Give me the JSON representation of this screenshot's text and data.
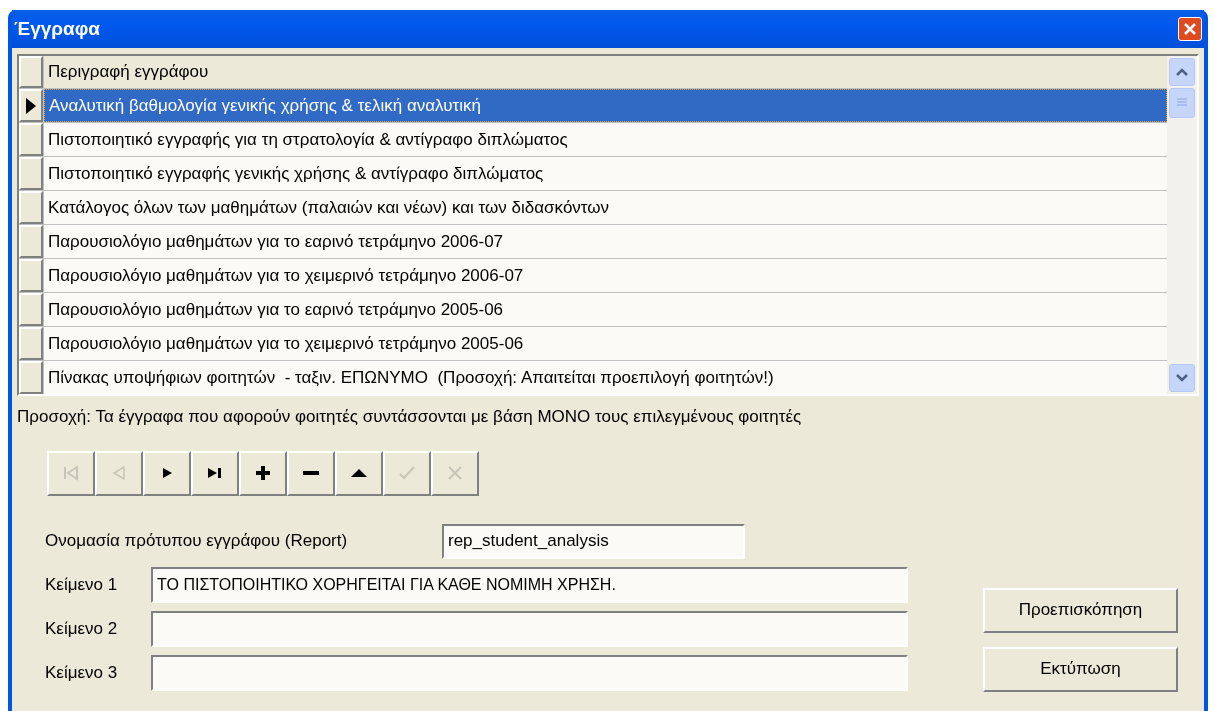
{
  "window": {
    "title": "Έγγραφα"
  },
  "table": {
    "columns": [
      "Περιγραφή εγγράφου"
    ],
    "rows": [
      {
        "text": "Αναλυτική βαθμολογία γενικής χρήσης & τελική αναλυτική",
        "selected": true
      },
      {
        "text": "Πιστοποιητικό εγγραφής για τη στρατολογία & αντίγραφο διπλώματος",
        "selected": false
      },
      {
        "text": "Πιστοποιητικό εγγραφής γενικής χρήσης & αντίγραφο διπλώματος",
        "selected": false
      },
      {
        "text": "Κατάλογος όλων των μαθημάτων (παλαιών και νέων) και των διδασκόντων",
        "selected": false
      },
      {
        "text": "Παρουσιολόγιο μαθημάτων για το εαρινό τετράμηνο 2006-07",
        "selected": false
      },
      {
        "text": "Παρουσιολόγιο μαθημάτων για το χειμερινό τετράμηνο 2006-07",
        "selected": false
      },
      {
        "text": "Παρουσιολόγιο μαθημάτων για το εαρινό τετράμηνο 2005-06",
        "selected": false
      },
      {
        "text": "Παρουσιολόγιο μαθημάτων για το χειμερινό τετράμηνο 2005-06",
        "selected": false
      },
      {
        "text": "Πίνακας υποψήφιων φοιτητών  - ταξιν. ΕΠΩΝΥΜΟ  (Προσοχή: Απαιτείται προεπιλογή φοιτητών!)",
        "selected": false
      }
    ]
  },
  "notice": "Προσοχή: Τα έγγραφα που αφορούν φοιτητές συντάσσονται με βάση ΜΟΝΟ τους επιλεγμένους φοιτητές",
  "navigator": [
    {
      "kind": "first",
      "disabled": true
    },
    {
      "kind": "previous",
      "disabled": true
    },
    {
      "kind": "next",
      "disabled": false
    },
    {
      "kind": "last",
      "disabled": false
    },
    {
      "kind": "add",
      "disabled": false
    },
    {
      "kind": "delete",
      "disabled": false
    },
    {
      "kind": "up",
      "disabled": false
    },
    {
      "kind": "save",
      "disabled": true
    },
    {
      "kind": "cancel",
      "disabled": true
    }
  ],
  "report_field": {
    "label": "Ονομασία πρότυπου εγγράφου (Report)",
    "value": "rep_student_analysis"
  },
  "text_fields": [
    {
      "label": "Κείμενο 1",
      "value": "ΤΟ ΠΙΣΤΟΠΟΙΗΤΙΚΟ ΧΟΡΗΓΕΙΤΑΙ ΓΙΑ ΚΑΘΕ ΝΟΜΙΜΗ ΧΡΗΣΗ."
    },
    {
      "label": "Κείμενο 2"
    },
    {
      "label": "Κείμενο 3"
    }
  ],
  "buttons": [
    "Προεπισκόπηση",
    "Εκτύπωση"
  ]
}
